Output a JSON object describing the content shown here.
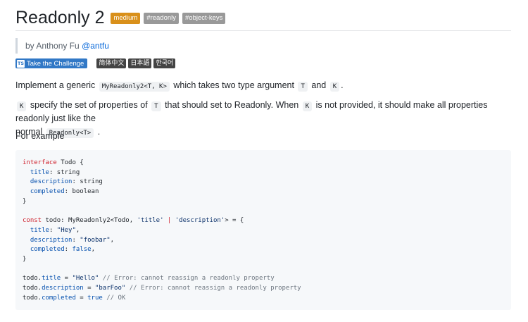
{
  "header": {
    "title": "Readonly 2",
    "difficulty": "medium",
    "tags": [
      "#readonly",
      "#object-keys"
    ]
  },
  "byline": {
    "prefix": "by Anthony Fu",
    "handle": "@antfu"
  },
  "buttons": {
    "ts_icon": "TS",
    "challenge": "Take the Challenge",
    "languages": [
      "简体中文",
      "日本語",
      "한국어"
    ]
  },
  "description": {
    "p1": {
      "a": "Implement a generic",
      "code1": "MyReadonly2<T, K>",
      "b": "which takes two type argument",
      "code2": "T",
      "c": "and",
      "code3": "K",
      "d": "."
    },
    "p2": {
      "code1": "K",
      "a": "specify the set of properties of",
      "code2": "T",
      "b": "that should set to Readonly. When",
      "code3": "K",
      "c": "is not provided, it should make all properties readonly just like the",
      "d": "normal",
      "code4": "Readonly<T>",
      "e": "."
    },
    "p3": "For example"
  },
  "code": {
    "t": {
      "interface": "interface",
      "todo_open": " Todo {",
      "ind": "  ",
      "title": "title",
      "string_type": ": string",
      "description": "description",
      "completed": "completed",
      "boolean_type": ": boolean",
      "close": "}",
      "const": "const",
      "todo_decl": " todo: MyReadonly2<Todo, ",
      "title_key": "'title'",
      "pipe": " | ",
      "desc_key": "'description'",
      "decl_end": "> = {",
      "colon": ": ",
      "hey": "\"Hey\"",
      "foobar": "\"foobar\"",
      "false": "false",
      "comma": ",",
      "todo_dot": "todo.",
      "assign": " = ",
      "hello": "\"Hello\"",
      "barfoo": "\"barFoo\"",
      "true": "true",
      "err": " // Error: cannot reassign a readonly property",
      "ok": " // OK"
    }
  },
  "colors": {
    "medium_badge": "#d9901a",
    "tag_badge": "#999999",
    "challenge_button": "#3178c6",
    "language_button": "#444444",
    "link": "#0969da"
  }
}
